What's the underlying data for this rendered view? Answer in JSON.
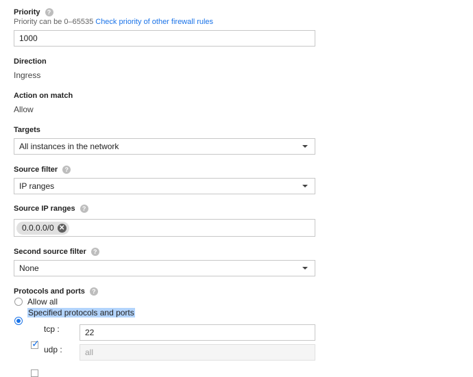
{
  "priority": {
    "label": "Priority",
    "hint_prefix": "Priority can be 0–65535",
    "hint_link": "Check priority of other firewall rules",
    "value": "1000"
  },
  "direction": {
    "label": "Direction",
    "value": "Ingress"
  },
  "action_on_match": {
    "label": "Action on match",
    "value": "Allow"
  },
  "targets": {
    "label": "Targets",
    "selected": "All instances in the network"
  },
  "source_filter": {
    "label": "Source filter",
    "selected": "IP ranges"
  },
  "source_ip_ranges": {
    "label": "Source IP ranges",
    "chips": [
      "0.0.0.0/0"
    ]
  },
  "second_source_filter": {
    "label": "Second source filter",
    "selected": "None"
  },
  "protocols_and_ports": {
    "label": "Protocols and ports",
    "options": [
      {
        "label": "Allow all",
        "selected": false
      },
      {
        "label": "Specified protocols and ports",
        "selected": true
      }
    ],
    "protocols": [
      {
        "label": "tcp :",
        "checked": true,
        "value": "22",
        "placeholder": ""
      },
      {
        "label": "udp :",
        "checked": false,
        "value": "",
        "placeholder": "all"
      }
    ]
  },
  "help_glyph": "?",
  "chip_remove_glyph": "✕",
  "check_glyph": "✓",
  "colors": {
    "accent": "#1a73e8",
    "selection": "#b3d4fc"
  }
}
